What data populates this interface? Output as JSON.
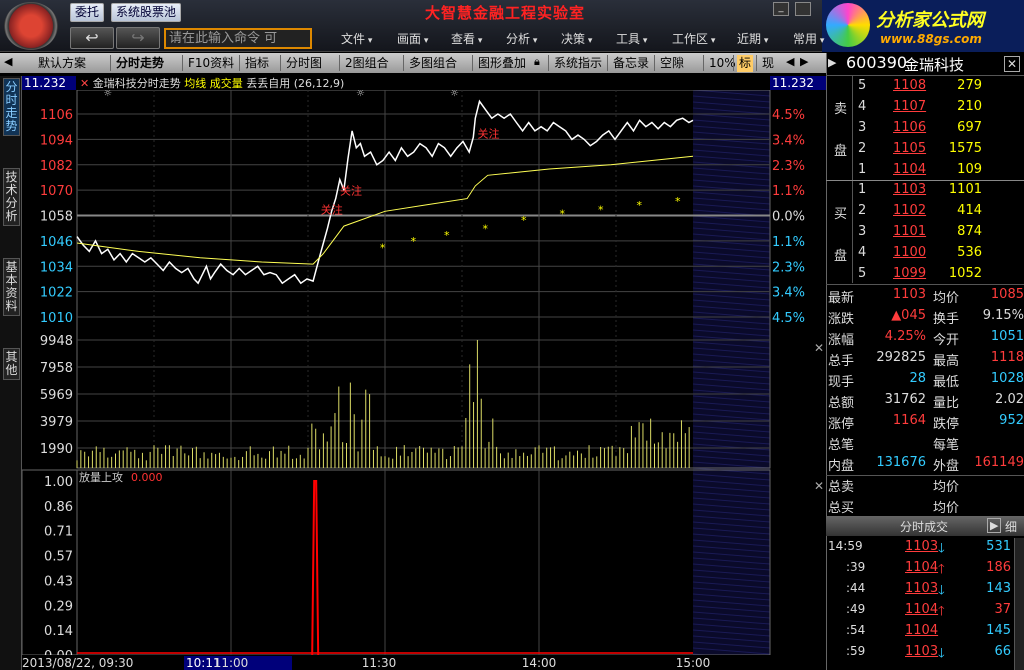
{
  "toolbar_top": {
    "btn_entrust": "委托",
    "btn_pool": "系统股票池",
    "app_title": "大智慧金融工程实验室",
    "cmd_placeholder": "请在此输入命令  可",
    "menus": [
      "文件",
      "画面",
      "查看",
      "分析",
      "决策",
      "工具",
      "工作区",
      "近期",
      "常用"
    ],
    "ad_text1": "分析家公式网",
    "ad_text2": "www.88gs.com"
  },
  "toolbar2": {
    "tabs": [
      "默认方案",
      "分时走势",
      "F10资料",
      "指标",
      "分时图",
      "2图组合",
      "多图组合",
      "图形叠加",
      "系统指示",
      "备忘录",
      "空隙",
      "10%",
      "标",
      "现"
    ]
  },
  "vtabs": [
    "分时走势",
    "技术分析",
    "基本资料",
    "其他"
  ],
  "chart": {
    "top_left_value": "11.232",
    "top_right_value": "11.232",
    "title_name": "金瑞科技分时走势",
    "title_avg": "均线",
    "title_vol": "成交量",
    "title_ind": "丢丢自用 (26,12,9)",
    "price_labels": [
      "1106",
      "1094",
      "1082",
      "1070",
      "1058",
      "1046",
      "1034",
      "1022",
      "1010"
    ],
    "pct_labels": [
      "4.5%",
      "3.4%",
      "2.3%",
      "1.1%",
      "0.0%",
      "1.1%",
      "2.3%",
      "3.4%",
      "4.5%"
    ],
    "vol_labels": [
      "9948",
      "7958",
      "5969",
      "3979",
      "1990"
    ],
    "ind_title": "放量上攻",
    "ind_value": "0.000",
    "ind_labels": [
      "1.00",
      "0.86",
      "0.71",
      "0.57",
      "0.43",
      "0.29",
      "0.14",
      "0.00"
    ],
    "annotations": [
      "关注",
      "关注",
      "关注"
    ],
    "date_label": "2013/08/22, 09:30",
    "cursor_time": "10:11",
    "time_labels": [
      "11:00",
      "11:30",
      "14:00",
      "15:00"
    ]
  },
  "chart_data": {
    "type": "line",
    "x_ticks": [
      "09:30",
      "10:00",
      "10:30",
      "11:00",
      "11:30",
      "13:30",
      "14:00",
      "14:30",
      "15:00"
    ],
    "price_axis_range": [
      1010,
      1106
    ],
    "base_price": 1058,
    "price_series": [
      [
        0,
        1048
      ],
      [
        6,
        1044
      ],
      [
        12,
        1041
      ],
      [
        18,
        1046
      ],
      [
        24,
        1040
      ],
      [
        30,
        1042
      ],
      [
        36,
        1037
      ],
      [
        42,
        1040
      ],
      [
        48,
        1036
      ],
      [
        54,
        1040
      ],
      [
        60,
        1038
      ],
      [
        66,
        1036
      ],
      [
        72,
        1038
      ],
      [
        78,
        1035
      ],
      [
        84,
        1032
      ],
      [
        90,
        1036
      ],
      [
        96,
        1033
      ],
      [
        102,
        1031
      ],
      [
        108,
        1033
      ],
      [
        114,
        1028
      ],
      [
        118,
        1026
      ],
      [
        122,
        1030
      ],
      [
        126,
        1034
      ],
      [
        130,
        1028
      ],
      [
        134,
        1031
      ],
      [
        140,
        1035
      ],
      [
        146,
        1032
      ],
      [
        152,
        1030
      ],
      [
        158,
        1033
      ],
      [
        164,
        1030
      ],
      [
        170,
        1032
      ],
      [
        176,
        1034
      ],
      [
        182,
        1030
      ],
      [
        188,
        1031
      ],
      [
        194,
        1030
      ],
      [
        200,
        1026
      ],
      [
        206,
        1028
      ],
      [
        212,
        1030
      ],
      [
        218,
        1026
      ],
      [
        224,
        1028
      ],
      [
        230,
        1027
      ],
      [
        236,
        1038
      ],
      [
        240,
        1045
      ],
      [
        244,
        1052
      ],
      [
        248,
        1060
      ],
      [
        252,
        1066
      ],
      [
        256,
        1075
      ],
      [
        260,
        1070
      ],
      [
        264,
        1085
      ],
      [
        268,
        1098
      ],
      [
        272,
        1090
      ],
      [
        276,
        1092
      ],
      [
        280,
        1086
      ],
      [
        286,
        1088
      ],
      [
        292,
        1082
      ],
      [
        298,
        1084
      ],
      [
        304,
        1088
      ],
      [
        310,
        1084
      ],
      [
        316,
        1090
      ],
      [
        322,
        1086
      ],
      [
        328,
        1088
      ],
      [
        334,
        1092
      ],
      [
        340,
        1090
      ],
      [
        346,
        1086
      ],
      [
        352,
        1092
      ],
      [
        358,
        1090
      ],
      [
        364,
        1086
      ],
      [
        370,
        1090
      ],
      [
        376,
        1093
      ],
      [
        382,
        1088
      ],
      [
        386,
        1095
      ],
      [
        388,
        1104
      ],
      [
        392,
        1112
      ],
      [
        398,
        1108
      ],
      [
        404,
        1104
      ],
      [
        410,
        1106
      ],
      [
        416,
        1104
      ],
      [
        422,
        1106
      ],
      [
        428,
        1102
      ],
      [
        434,
        1098
      ],
      [
        440,
        1102
      ],
      [
        446,
        1098
      ],
      [
        452,
        1100
      ],
      [
        458,
        1098
      ],
      [
        464,
        1102
      ],
      [
        470,
        1100
      ],
      [
        476,
        1098
      ],
      [
        482,
        1094
      ],
      [
        488,
        1096
      ],
      [
        494,
        1094
      ],
      [
        500,
        1091
      ],
      [
        506,
        1093
      ],
      [
        512,
        1096
      ],
      [
        518,
        1098
      ],
      [
        524,
        1094
      ],
      [
        530,
        1098
      ],
      [
        536,
        1102
      ],
      [
        542,
        1098
      ],
      [
        548,
        1103
      ],
      [
        554,
        1100
      ],
      [
        560,
        1102
      ],
      [
        566,
        1099
      ],
      [
        572,
        1102
      ],
      [
        578,
        1100
      ],
      [
        584,
        1103
      ],
      [
        590,
        1104
      ],
      [
        596,
        1102
      ],
      [
        600,
        1103
      ]
    ],
    "avg_series": [
      [
        0,
        1045
      ],
      [
        60,
        1041
      ],
      [
        120,
        1038
      ],
      [
        180,
        1036
      ],
      [
        230,
        1035
      ],
      [
        240,
        1040
      ],
      [
        260,
        1053
      ],
      [
        300,
        1060
      ],
      [
        340,
        1063
      ],
      [
        380,
        1066
      ],
      [
        388,
        1072
      ],
      [
        400,
        1077
      ],
      [
        460,
        1080
      ],
      [
        520,
        1082
      ],
      [
        560,
        1084
      ],
      [
        600,
        1086
      ]
    ],
    "volume_axis_range": [
      0,
      9948
    ],
    "indicator_axis_range": [
      0,
      1.0
    ],
    "indicator_spike_minute": 232,
    "indicator_spike_value": 1.0
  },
  "quote": {
    "code": "600390",
    "name": "金瑞科技",
    "sell_label_1": "卖",
    "sell_label_2": "盘",
    "buy_label_1": "买",
    "buy_label_2": "盘",
    "sell": [
      {
        "lvl": "5",
        "price": "1108",
        "vol": "279"
      },
      {
        "lvl": "4",
        "price": "1107",
        "vol": "210"
      },
      {
        "lvl": "3",
        "price": "1106",
        "vol": "697"
      },
      {
        "lvl": "2",
        "price": "1105",
        "vol": "1575"
      },
      {
        "lvl": "1",
        "price": "1104",
        "vol": "109"
      }
    ],
    "buy": [
      {
        "lvl": "1",
        "price": "1103",
        "vol": "1101"
      },
      {
        "lvl": "2",
        "price": "1102",
        "vol": "414"
      },
      {
        "lvl": "3",
        "price": "1101",
        "vol": "874"
      },
      {
        "lvl": "4",
        "price": "1100",
        "vol": "536"
      },
      {
        "lvl": "5",
        "price": "1099",
        "vol": "1052"
      }
    ],
    "stats": [
      {
        "k1": "最新",
        "v1": "1103",
        "c1": "red",
        "k2": "均价",
        "v2": "1085",
        "c2": "red"
      },
      {
        "k1": "涨跌",
        "v1": "▲045",
        "c1": "red",
        "k2": "换手",
        "v2": "9.15%",
        "c2": "white"
      },
      {
        "k1": "涨幅",
        "v1": "4.25%",
        "c1": "red",
        "k2": "今开",
        "v2": "1051",
        "c2": "green"
      },
      {
        "k1": "总手",
        "v1": "292825",
        "c1": "white",
        "k2": "最高",
        "v2": "1118",
        "c2": "red"
      },
      {
        "k1": "现手",
        "v1": "28",
        "c1": "green",
        "k2": "最低",
        "v2": "1028",
        "c2": "green"
      },
      {
        "k1": "总额",
        "v1": "31762",
        "c1": "white",
        "k2": "量比",
        "v2": "2.02",
        "c2": "white"
      },
      {
        "k1": "涨停",
        "v1": "1164",
        "c1": "red",
        "k2": "跌停",
        "v2": "952",
        "c2": "green"
      },
      {
        "k1": "总笔",
        "v1": "",
        "c1": "white",
        "k2": "每笔",
        "v2": "",
        "c2": "white"
      },
      {
        "k1": "内盘",
        "v1": "131676",
        "c1": "green",
        "k2": "外盘",
        "v2": "161149",
        "c2": "red"
      }
    ],
    "buysell": [
      {
        "k1": "总卖",
        "k2": "均价"
      },
      {
        "k1": "总买",
        "k2": "均价"
      }
    ],
    "ticks_header": "分时成交",
    "ticks_btn": "细",
    "ticks": [
      {
        "t": "14:59",
        "p": "1103",
        "d": "down",
        "v": "531",
        "vc": "green"
      },
      {
        "t": ":39",
        "p": "1104",
        "d": "up",
        "v": "186",
        "vc": "red"
      },
      {
        "t": ":44",
        "p": "1103",
        "d": "down",
        "v": "143",
        "vc": "green"
      },
      {
        "t": ":49",
        "p": "1104",
        "d": "up",
        "v": "37",
        "vc": "red"
      },
      {
        "t": ":54",
        "p": "1104",
        "d": "",
        "v": "145",
        "vc": "green"
      },
      {
        "t": ":59",
        "p": "1103",
        "d": "down",
        "v": "66",
        "vc": "green"
      }
    ]
  },
  "colors": {
    "price_line": "#ffffff",
    "avg_line": "#ffff55",
    "up": "#ff3c3c",
    "down": "#33ccff",
    "grid": "#444444",
    "volume": "#dddd66",
    "indicator": "#ff0000"
  }
}
